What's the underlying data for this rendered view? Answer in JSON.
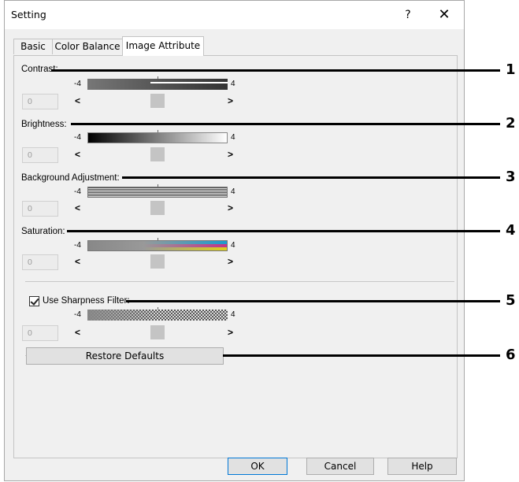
{
  "dialog": {
    "title": "Setting",
    "help_glyph": "?",
    "close_glyph": "✕",
    "tabs": [
      {
        "label": "Basic",
        "active": false
      },
      {
        "label": "Color Balance",
        "active": false
      },
      {
        "label": "Image Attribute",
        "active": true
      }
    ]
  },
  "sections": [
    {
      "label": "Contrast:",
      "min_label": "-4",
      "max_label": "4",
      "value": "0",
      "left_arrow": "<",
      "right_arrow": ">",
      "callout": "1"
    },
    {
      "label": "Brightness:",
      "min_label": "-4",
      "max_label": "4",
      "value": "0",
      "left_arrow": "<",
      "right_arrow": ">",
      "callout": "2"
    },
    {
      "label": "Background Adjustment:",
      "min_label": "-4",
      "max_label": "4",
      "value": "0",
      "left_arrow": "<",
      "right_arrow": ">",
      "callout": "3"
    },
    {
      "label": "Saturation:",
      "min_label": "-4",
      "max_label": "4",
      "value": "0",
      "left_arrow": "<",
      "right_arrow": ">",
      "callout": "4"
    }
  ],
  "sharpness": {
    "label": "Use Sharpness Filter:",
    "checked": true,
    "min_label": "-4",
    "max_label": "4",
    "value": "0",
    "left_arrow": "<",
    "right_arrow": ">",
    "callout": "5"
  },
  "restore": {
    "label": "Restore Defaults",
    "callout": "6"
  },
  "buttons": {
    "ok": "OK",
    "cancel": "Cancel",
    "help": "Help"
  },
  "colors": {
    "dialog_bg": "#f0f0f0",
    "ok_border": "#0078d7",
    "thumb": "#c4c4c4"
  }
}
